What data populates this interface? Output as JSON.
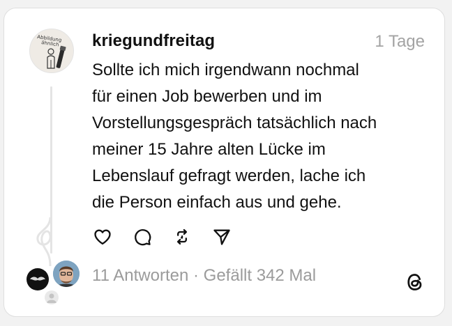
{
  "post": {
    "username": "kriegundfreitag",
    "timestamp": "1 Tage",
    "body_lines": [
      "Sollte ich mich irgendwann nochmal",
      "für einen Job bewerben und im",
      "Vorstellungsgespräch tatsächlich nach",
      "meiner 15 Jahre alten Lücke im",
      "Lebenslauf gefragt werden, lache ich",
      "die Person einfach aus und gehe."
    ],
    "avatar_caption": [
      "Abbildung",
      "ähnlich"
    ]
  },
  "actions": [
    {
      "icon": "heart-icon"
    },
    {
      "icon": "comment-icon"
    },
    {
      "icon": "repost-icon"
    },
    {
      "icon": "share-icon"
    }
  ],
  "footer": {
    "replies": "11 Antworten",
    "separator": " · ",
    "likes": "Gefällt 342 Mal"
  },
  "colors": {
    "text": "#111111",
    "muted": "#a3a3a3",
    "thread_line": "#e4e4e4",
    "card_border": "#dedede"
  }
}
